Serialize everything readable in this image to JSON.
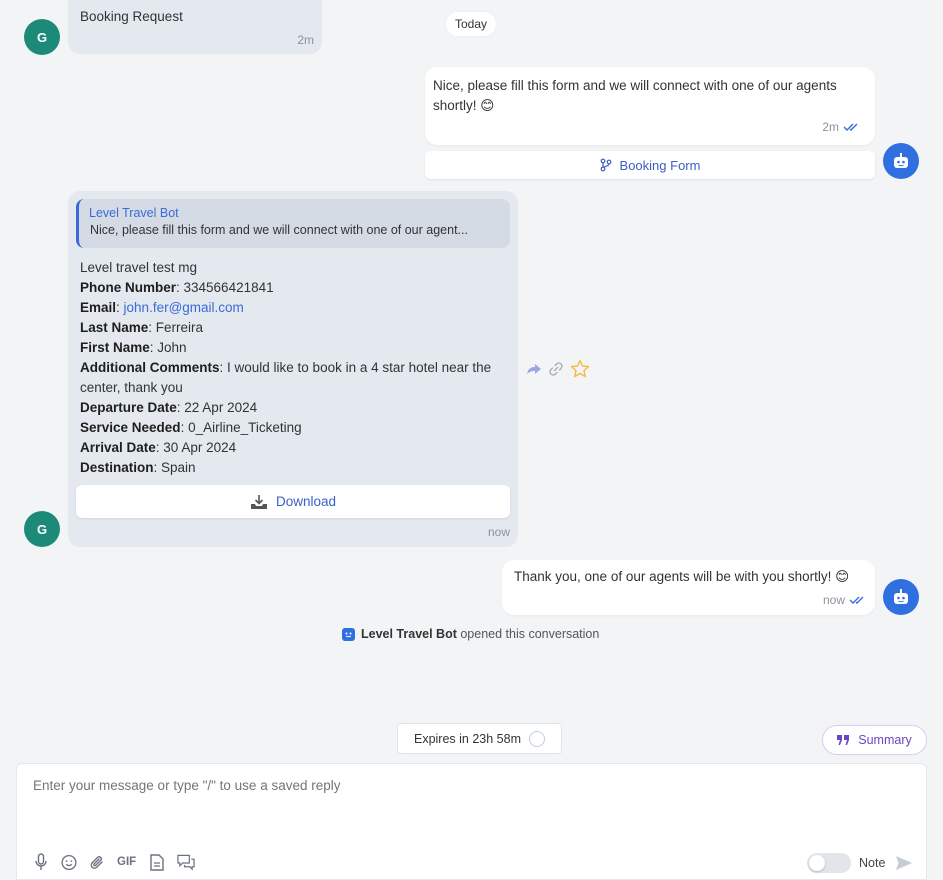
{
  "date_divider": "Today",
  "messages": {
    "m1": {
      "avatar": "G",
      "text": "Booking Request",
      "time": "2m"
    },
    "m2": {
      "text": "Nice, please fill this form and we will connect with one of our agents shortly! 😊",
      "time": "2m",
      "button_label": "Booking Form"
    },
    "m3": {
      "avatar": "G",
      "reply_author": "Level Travel Bot",
      "reply_text": "Nice, please fill this form and we will connect with one of our agent...",
      "intro": "Level travel test mg",
      "fields": [
        {
          "label": "Phone Number",
          "value": ": 334566421841"
        },
        {
          "label": "Email",
          "value": "john.fer@gmail.com"
        },
        {
          "label": "Last Name",
          "value": ": Ferreira"
        },
        {
          "label": "First Name",
          "value": ": John"
        },
        {
          "label": "Additional Comments",
          "value": ": I would like to book in a 4 star hotel near the center, thank you"
        },
        {
          "label": "Departure Date",
          "value": ": 22 Apr 2024"
        },
        {
          "label": "Service Needed",
          "value": ": 0_Airline_Ticketing"
        },
        {
          "label": "Arrival Date",
          "value": ": 30 Apr 2024"
        },
        {
          "label": "Destination",
          "value": ": Spain"
        }
      ],
      "download_label": "Download",
      "time": "now"
    },
    "m4": {
      "text": "Thank you, one of our agents will be with you shortly! 😊",
      "time": "now"
    }
  },
  "activity": {
    "actor": "Level Travel Bot",
    "text": " opened this conversation"
  },
  "expires": "Expires in 23h 58m",
  "summary_label": "Summary",
  "composer": {
    "placeholder": "Enter your message or type \"/\" to use a saved reply",
    "gif_label": "GIF",
    "note_label": "Note"
  },
  "icons": {
    "mic": "mic-icon",
    "emoji": "emoji-icon",
    "attach": "paperclip-icon",
    "doc": "document-icon",
    "chat": "chat-bubbles-icon",
    "send": "send-icon",
    "forward": "forward-icon",
    "link": "link-icon",
    "star": "star-icon",
    "bot": "bot-icon",
    "branch": "branch-icon",
    "download": "download-icon",
    "double_check": "double-check-icon",
    "quote": "quote-icon",
    "timer": "timer-circle-icon"
  },
  "colors": {
    "accent": "#3b6bd8",
    "bot_avatar": "#2f6fe0",
    "contact_avatar": "#1d8a79",
    "summary": "#6b46c1",
    "star": "#f5b942"
  }
}
